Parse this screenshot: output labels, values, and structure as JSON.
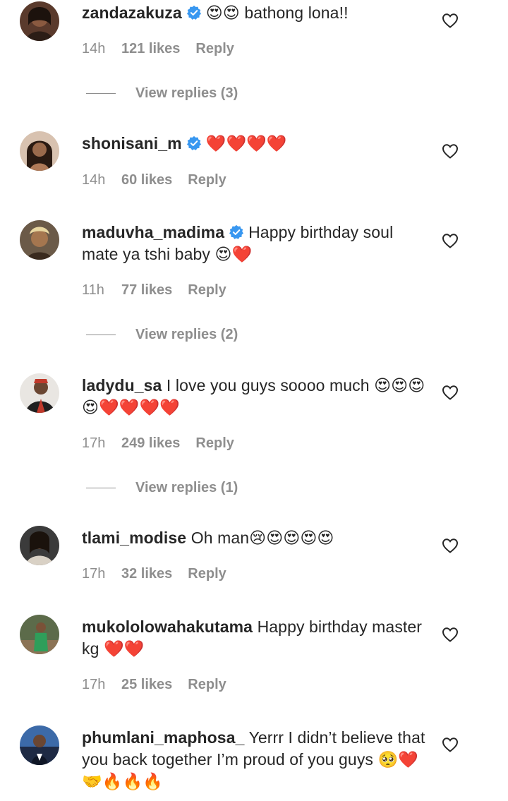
{
  "colors": {
    "text": "#262626",
    "secondary": "#8e8e8e",
    "verified": "#3897f0",
    "background": "#ffffff"
  },
  "comments": [
    {
      "username": "zandazakuza",
      "verified": true,
      "body": "😍😍 bathong lona!!",
      "time": "14h",
      "likes": "121 likes",
      "reply": "Reply",
      "view_replies": "View replies (3)"
    },
    {
      "username": "shonisani_m",
      "verified": true,
      "body": "❤️❤️❤️❤️",
      "time": "14h",
      "likes": "60 likes",
      "reply": "Reply"
    },
    {
      "username": "maduvha_madima",
      "verified": true,
      "body": "Happy birthday soul mate ya tshi baby 😍❤️",
      "time": "11h",
      "likes": "77 likes",
      "reply": "Reply",
      "view_replies": "View replies (2)"
    },
    {
      "username": "ladydu_sa",
      "verified": false,
      "body": "I love you guys soooo much 😍😍😍😍❤️❤️❤️❤️",
      "time": "17h",
      "likes": "249 likes",
      "reply": "Reply",
      "view_replies": "View replies (1)"
    },
    {
      "username": "tlami_modise",
      "verified": false,
      "body": "Oh man😢😍😍😍😍",
      "time": "17h",
      "likes": "32 likes",
      "reply": "Reply"
    },
    {
      "username": "mukololowahakutama",
      "verified": false,
      "body": "Happy birthday master kg ❤️❤️",
      "time": "17h",
      "likes": "25 likes",
      "reply": "Reply"
    },
    {
      "username": "phumlani_maphosa_",
      "verified": false,
      "body": "Yerrr I didn’t believe that you back together I’m proud of you guys 🥺❤️🤝🔥🔥🔥"
    }
  ]
}
